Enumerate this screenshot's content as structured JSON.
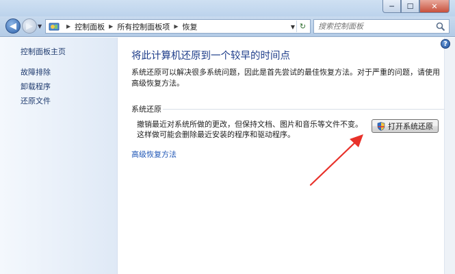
{
  "window": {
    "minimize_label": "─",
    "maximize_label": "☐",
    "close_label": "✕"
  },
  "nav": {
    "back_label": "◀",
    "forward_label": "▶",
    "breadcrumbs": [
      "控制面板",
      "所有控制面板项",
      "恢复"
    ],
    "search_placeholder": "搜索控制面板",
    "refresh_label": "↻"
  },
  "sidebar": {
    "items": [
      {
        "label": "控制面板主页"
      },
      {
        "label": "故障排除"
      },
      {
        "label": "卸载程序"
      },
      {
        "label": "还原文件"
      }
    ]
  },
  "main": {
    "help_label": "?",
    "title": "将此计算机还原到一个较早的时间点",
    "description": "系统还原可以解决很多系统问题，因此是首先尝试的最佳恢复方法。对于严重的问题，请使用高级恢复方法。",
    "section_label": "系统还原",
    "restore_description": "撤销最近对系统所做的更改，但保持文档、图片和音乐等文件不变。这样做可能会删除最近安装的程序和驱动程序。",
    "restore_button_label": "打开系统还原",
    "advanced_link": "高级恢复方法"
  },
  "colors": {
    "accent_title": "#1e3d8a",
    "link": "#1e55b5",
    "annotation_arrow": "#e8312a"
  },
  "icons": [
    "back-arrow-icon",
    "forward-arrow-icon",
    "control-panel-icon",
    "refresh-icon",
    "search-icon",
    "help-icon",
    "uac-shield-icon",
    "annotation-arrow"
  ]
}
